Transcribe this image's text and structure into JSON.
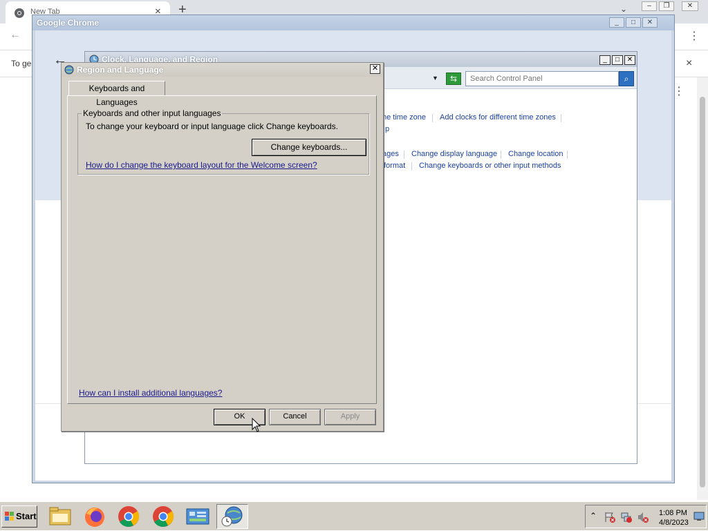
{
  "chrome": {
    "tab_title": "New Tab",
    "tab_close": "×",
    "new_tab": "+",
    "infobar_text": "To ge",
    "infobar_close": "×"
  },
  "gc_window": {
    "title": "Google Chrome"
  },
  "clr_window": {
    "title": "Clock, Language, and Region",
    "search_placeholder": "Search Control Panel",
    "links": {
      "set_time_zone": "he time zone",
      "add_clocks": "Add clocks for different time zones",
      "gadget": "p",
      "languages": "ages",
      "change_display_language": "Change display language",
      "change_location": "Change location",
      "format": "format",
      "change_keyboards": "Change keyboards or other input methods"
    }
  },
  "rl_dialog": {
    "title": "Region and Language",
    "tab_label": "Keyboards and Languages",
    "group_legend": "Keyboards and other input languages",
    "group_text": "To change your keyboard or input language click Change keyboards.",
    "change_keyboards_button": "Change keyboards...",
    "welcome_link": "How do I change the keyboard layout for the Welcome screen?",
    "install_link": "How can I install additional languages?",
    "ok": "OK",
    "cancel": "Cancel",
    "apply": "Apply"
  },
  "taskbar": {
    "start_label": "Start",
    "clock_time": "1:08 PM",
    "clock_date": "4/8/2023"
  }
}
